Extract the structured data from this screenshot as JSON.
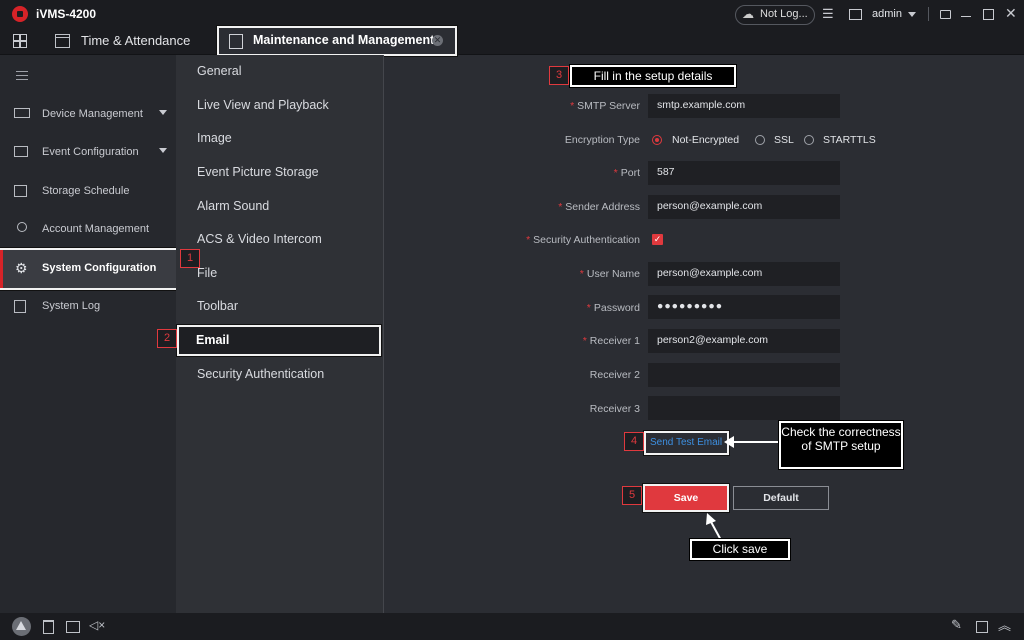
{
  "app": {
    "title": "iVMS-4200"
  },
  "titlebar": {
    "cloud_status": "Not Log...",
    "user": "admin"
  },
  "tabs": [
    {
      "label": "Time & Attendance"
    },
    {
      "label": "Maintenance and Management"
    }
  ],
  "sidebar": {
    "items": [
      {
        "label": "Device Management",
        "has_submenu": true
      },
      {
        "label": "Event Configuration",
        "has_submenu": true
      },
      {
        "label": "Storage Schedule"
      },
      {
        "label": "Account Management"
      },
      {
        "label": "System Configuration",
        "selected": true
      },
      {
        "label": "System Log"
      }
    ]
  },
  "submenu": {
    "items": [
      {
        "label": "General"
      },
      {
        "label": "Live View and Playback"
      },
      {
        "label": "Image"
      },
      {
        "label": "Event Picture Storage"
      },
      {
        "label": "Alarm Sound"
      },
      {
        "label": "ACS & Video Intercom"
      },
      {
        "label": "File"
      },
      {
        "label": "Toolbar"
      },
      {
        "label": "Email",
        "selected": true
      },
      {
        "label": "Security Authentication"
      }
    ]
  },
  "form": {
    "smtp_server": {
      "label": "SMTP Server",
      "required": true,
      "value": "smtp.example.com"
    },
    "encryption": {
      "label": "Encryption Type",
      "options": [
        "Not-Encrypted",
        "SSL",
        "STARTTLS"
      ],
      "selected": "Not-Encrypted"
    },
    "port": {
      "label": "Port",
      "required": true,
      "value": "587"
    },
    "sender": {
      "label": "Sender Address",
      "required": true,
      "value": "person@example.com"
    },
    "security_auth": {
      "label": "Security Authentication",
      "required": true,
      "checked": true
    },
    "username": {
      "label": "User Name",
      "required": true,
      "value": "person@example.com"
    },
    "password": {
      "label": "Password",
      "required": true,
      "value": "●●●●●●●●●"
    },
    "receiver1": {
      "label": "Receiver 1",
      "required": true,
      "value": "person2@example.com"
    },
    "receiver2": {
      "label": "Receiver 2",
      "value": ""
    },
    "receiver3": {
      "label": "Receiver 3",
      "value": ""
    },
    "test_link": "Send Test Email",
    "save_label": "Save",
    "default_label": "Default"
  },
  "annotations": {
    "step1": "1",
    "step2": "2",
    "step3": "3",
    "step4": "4",
    "step5": "5",
    "callout_setup": "Fill in the setup details",
    "callout_check": "Check the correctness of SMTP setup",
    "callout_save": "Click save"
  },
  "colors": {
    "accent": "#e0393e",
    "link": "#3d8fe0",
    "background": "#2b2d33"
  }
}
